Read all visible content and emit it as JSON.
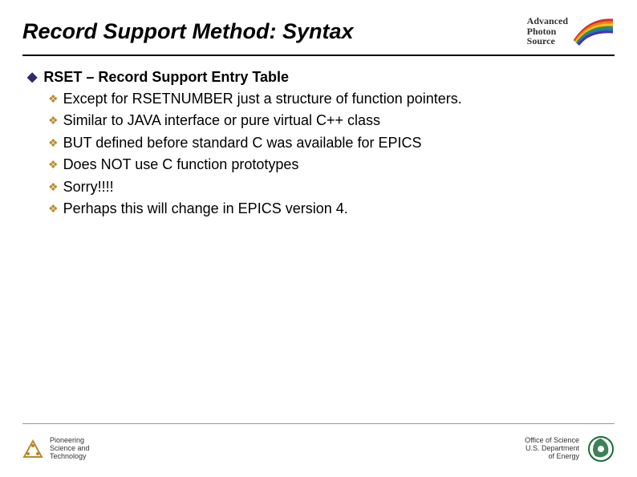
{
  "title": "Record Support Method: Syntax",
  "logo": {
    "line1": "Advanced",
    "line2": "Photon",
    "line3": "Source"
  },
  "content": {
    "lvl1": "RSET – Record Support Entry Table",
    "items": [
      "Except for RSETNUMBER just a structure of function pointers.",
      "Similar to JAVA interface or pure virtual C++ class",
      "BUT defined before standard C was available for EPICS",
      "Does NOT use C function prototypes",
      "Sorry!!!!",
      "Perhaps this will change in EPICS version 4."
    ]
  },
  "footer": {
    "left": {
      "l1": "Pioneering",
      "l2": "Science and",
      "l3": "Technology"
    },
    "right": {
      "l1": "Office of Science",
      "l2": "U.S. Department",
      "l3": "of Energy"
    }
  }
}
